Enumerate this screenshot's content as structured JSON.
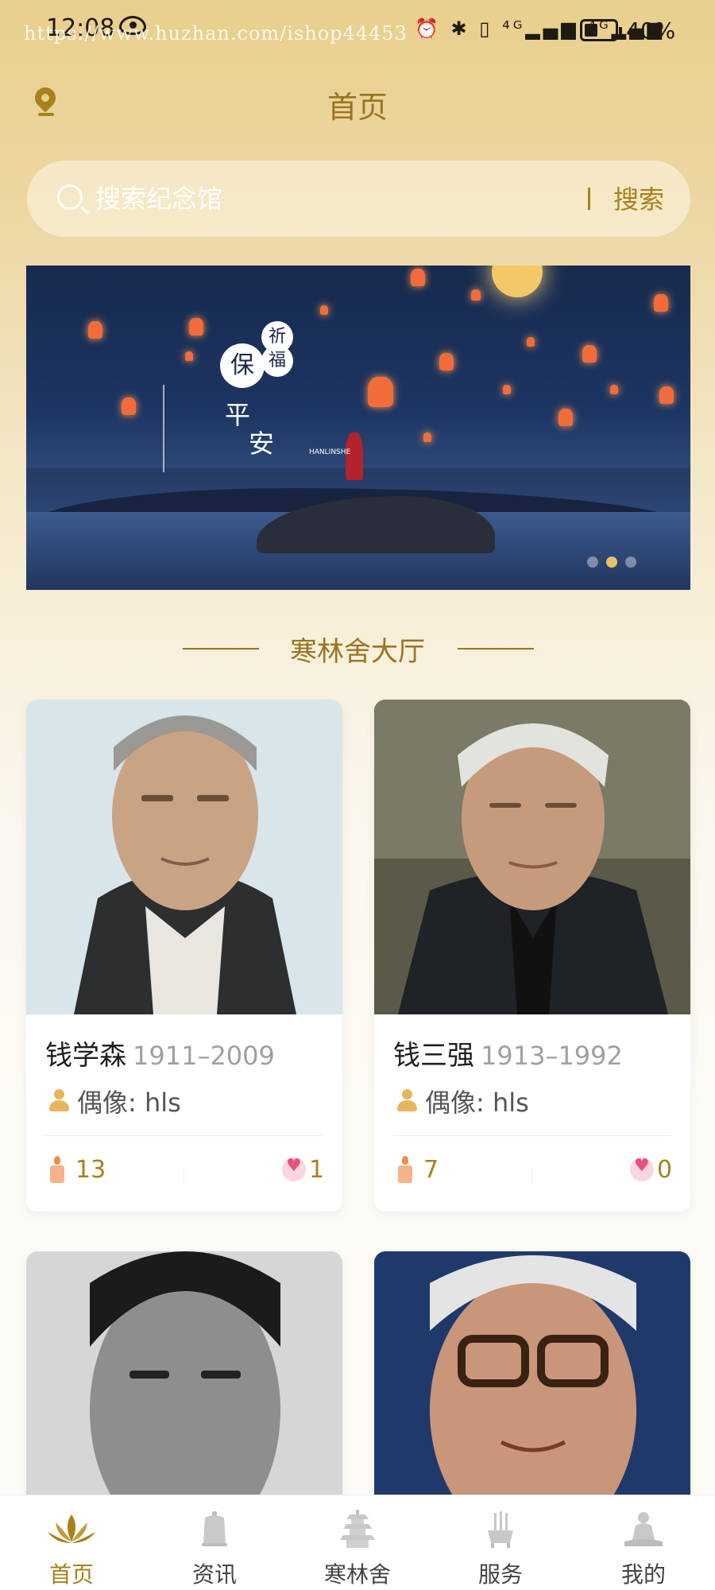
{
  "status_bar": {
    "time": "12:08",
    "watermark": "https://www.huzhan.com/ishop44453",
    "icons_text": "⏰ ✱ ▯ ⁴ᴳ▂▄▆ ⁴ᴳ▂▄▆",
    "battery": "40%"
  },
  "header": {
    "title": "首页",
    "location_icon": "location-pin-icon"
  },
  "search": {
    "placeholder": "搜索纪念馆",
    "button": "搜索"
  },
  "banner": {
    "char_bao": "保",
    "char_qi": "祈",
    "char_fu": "福",
    "char_ping": "平",
    "char_an": "安",
    "brand": "HANLINSHE",
    "active_slide": 2,
    "slide_count": 3,
    "accent": "#e6c06a"
  },
  "section": {
    "title": "寒林舍大厅"
  },
  "cards": [
    {
      "name": "钱学森",
      "years": "1911–2009",
      "idol": "偶像: hls",
      "candles": "13",
      "flowers": "1"
    },
    {
      "name": "钱三强",
      "years": "1913–1992",
      "idol": "偶像: hls",
      "candles": "7",
      "flowers": "0"
    },
    {
      "name": "",
      "years": "",
      "idol": "",
      "candles": "",
      "flowers": ""
    },
    {
      "name": "",
      "years": "",
      "idol": "",
      "candles": "",
      "flowers": ""
    }
  ],
  "tabbar": {
    "items": [
      {
        "label": "首页",
        "icon": "lotus-icon",
        "active": true
      },
      {
        "label": "资讯",
        "icon": "bell-icon",
        "active": false
      },
      {
        "label": "寒林舍",
        "icon": "pagoda-icon",
        "active": false
      },
      {
        "label": "服务",
        "icon": "incense-burner-icon",
        "active": false
      },
      {
        "label": "我的",
        "icon": "buddha-icon",
        "active": false
      }
    ]
  },
  "colors": {
    "brand_gold": "#a8801c",
    "title_gold": "#9a7420",
    "header_bg": "#e9cf8c"
  }
}
